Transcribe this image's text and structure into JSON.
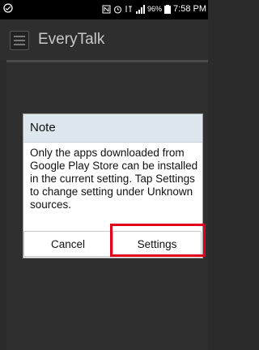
{
  "status_bar": {
    "battery": "96%",
    "time": "7:58 PM"
  },
  "app": {
    "title": "EveryTalk"
  },
  "dialog": {
    "title": "Note",
    "message": "Only the apps downloaded from Google Play Store can be installed in the current setting. Tap Settings to change setting under Unknown sources.",
    "cancel_label": "Cancel",
    "settings_label": "Settings"
  },
  "colors": {
    "highlight": "#e0001b",
    "dialog_title_bg": "#dde7ee"
  },
  "icons": [
    "messenger-icon",
    "nfc-icon",
    "alarm-icon",
    "lte-icon",
    "signal-icon",
    "battery-icon",
    "app-icon"
  ]
}
